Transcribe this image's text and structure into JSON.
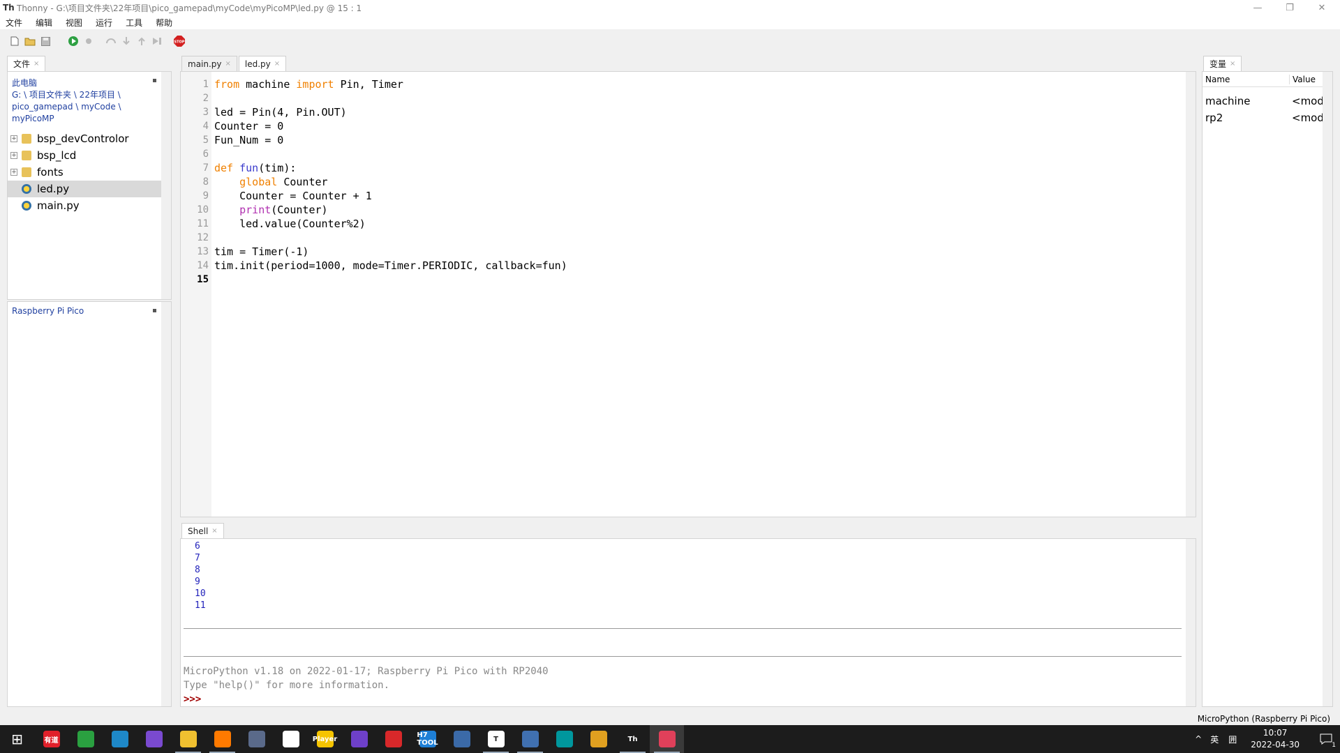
{
  "window": {
    "app_name": "Thonny",
    "title": "Thonny  -  G:\\项目文件夹\\22年项目\\pico_gamepad\\myCode\\myPicoMP\\led.py  @  15 : 1",
    "controls": {
      "minimize": "—",
      "restore": "❐",
      "close": "✕"
    }
  },
  "menu": [
    "文件",
    "编辑",
    "视图",
    "运行",
    "工具",
    "帮助"
  ],
  "toolbar": {
    "new": "new-file-icon",
    "open": "open-folder-icon",
    "save": "save-icon",
    "run": "run-icon",
    "debug": "debug-icon",
    "step_over": "step-over-icon",
    "step_into": "step-into-icon",
    "step_out": "step-out-icon",
    "resume": "resume-icon",
    "stop": "stop-icon",
    "stop_label": "STOP"
  },
  "files_panel": {
    "tab": "文件",
    "location_label": "此电脑",
    "path_lines": [
      "G: \\ 项目文件夹 \\ 22年项目 \\",
      "pico_gamepad \\ myCode \\",
      "myPicoMP"
    ],
    "items": [
      {
        "name": "bsp_devControlor",
        "type": "folder"
      },
      {
        "name": "bsp_lcd",
        "type": "folder"
      },
      {
        "name": "fonts",
        "type": "folder"
      },
      {
        "name": "led.py",
        "type": "python",
        "selected": true
      },
      {
        "name": "main.py",
        "type": "python"
      }
    ],
    "device_label": "Raspberry Pi Pico"
  },
  "editor": {
    "tabs": [
      {
        "label": "main.py",
        "active": false
      },
      {
        "label": "led.py",
        "active": true
      }
    ],
    "line_numbers": [
      "1",
      "2",
      "3",
      "4",
      "5",
      "6",
      "7",
      "8",
      "9",
      "10",
      "11",
      "12",
      "13",
      "14",
      "15"
    ],
    "current_line": "15",
    "code": [
      [
        {
          "t": "from",
          "c": "kw"
        },
        {
          "t": " machine "
        },
        {
          "t": "import",
          "c": "kw"
        },
        {
          "t": " Pin, Timer"
        }
      ],
      [],
      [
        {
          "t": "led = Pin(4, Pin.OUT)"
        }
      ],
      [
        {
          "t": "Counter = 0"
        }
      ],
      [
        {
          "t": "Fun_Num = 0"
        }
      ],
      [],
      [
        {
          "t": "def",
          "c": "kw"
        },
        {
          "t": " "
        },
        {
          "t": "fun",
          "c": "fn"
        },
        {
          "t": "(tim):"
        }
      ],
      [
        {
          "t": "    "
        },
        {
          "t": "global",
          "c": "kw"
        },
        {
          "t": " Counter"
        }
      ],
      [
        {
          "t": "    Counter = Counter + 1"
        }
      ],
      [
        {
          "t": "    "
        },
        {
          "t": "print",
          "c": "bi"
        },
        {
          "t": "(Counter)"
        }
      ],
      [
        {
          "t": "    led.value(Counter%2)"
        }
      ],
      [],
      [
        {
          "t": "tim = Timer(-1)"
        }
      ],
      [
        {
          "t": "tim.init(period=1000, mode=Timer.PERIODIC, callback=fun)"
        }
      ],
      []
    ]
  },
  "shell": {
    "tab": "Shell",
    "output": [
      "6",
      "7",
      "8",
      "9",
      "10",
      "11"
    ],
    "banner": "MicroPython v1.18 on 2022-01-17; Raspberry Pi Pico with RP2040",
    "help_hint": "Type \"help()\" for more information.",
    "prompt": ">>>"
  },
  "variables": {
    "tab": "变量",
    "headers": [
      "Name",
      "Value"
    ],
    "rows": [
      {
        "name": "machine",
        "value": "<mod"
      },
      {
        "name": "rp2",
        "value": "<mod"
      }
    ]
  },
  "status": {
    "interpreter": "MicroPython (Raspberry Pi Pico)"
  },
  "taskbar": {
    "apps": [
      {
        "name": "start-icon",
        "label": "⊞",
        "color": "#1c1c1c"
      },
      {
        "name": "youdao-icon",
        "label": "有道",
        "color": "#e0202a"
      },
      {
        "name": "360-icon",
        "label": "",
        "color": "#2aa040"
      },
      {
        "name": "edge-icon",
        "label": "",
        "color": "#1e88c8"
      },
      {
        "name": "purple-app-icon",
        "label": "",
        "color": "#7a4ad0"
      },
      {
        "name": "file-explorer-icon",
        "label": "",
        "color": "#f0c030",
        "open": true
      },
      {
        "name": "search-app-icon",
        "label": "",
        "color": "#ff7a00",
        "open": true
      },
      {
        "name": "calculator-icon",
        "label": "",
        "color": "#5a6a8a"
      },
      {
        "name": "baidu-netdisk-icon",
        "label": "",
        "color": "#ffffff"
      },
      {
        "name": "potplayer-icon",
        "label": "Player",
        "color": "#f5c400"
      },
      {
        "name": "github-icon",
        "label": "",
        "color": "#6e40c9"
      },
      {
        "name": "red-app-icon",
        "label": "",
        "color": "#d8282a"
      },
      {
        "name": "h7tool-icon",
        "label": "H7 TOOL",
        "color": "#1e7fd6"
      },
      {
        "name": "serial-tool-icon",
        "label": "",
        "color": "#3b6aa8"
      },
      {
        "name": "typora-icon",
        "label": "T",
        "color": "#ffffff",
        "open": true
      },
      {
        "name": "remote-icon",
        "label": "",
        "color": "#4070b0",
        "open": true
      },
      {
        "name": "arduino-icon",
        "label": "",
        "color": "#00979d"
      },
      {
        "name": "chrome-icon",
        "label": "",
        "color": "#e0a020"
      },
      {
        "name": "thonny-icon",
        "label": "Th",
        "color": "#1c1c1c",
        "open": true
      },
      {
        "name": "screen-record-icon",
        "label": "",
        "color": "#e0405a",
        "open": true,
        "active": true
      }
    ],
    "tray": {
      "chevron": "^",
      "ime": "英",
      "ime2": "囲",
      "time": "10:07",
      "date": "2022-04-30",
      "notifications": "1"
    }
  }
}
